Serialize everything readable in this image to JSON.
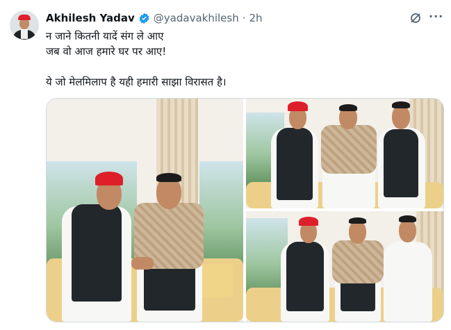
{
  "tweet": {
    "author_name": "Akhilesh Yadav",
    "handle": "@yadavakhilesh",
    "separator": "·",
    "time": "2h",
    "lines": [
      "न जाने कितनी यादें संग ले आए",
      "जब वो आज हमारे घर पर आए!",
      "ये जो मेलमिलाप है यही हमारी साझा विरासत है।"
    ],
    "more_label": "···"
  },
  "icons": {
    "verified": "verified-badge-icon",
    "grok": "grok-icon",
    "more": "more-options-icon"
  },
  "colors": {
    "verified": "#1d9bf0",
    "secondary_text": "#536471",
    "border": "#cfd9de"
  }
}
